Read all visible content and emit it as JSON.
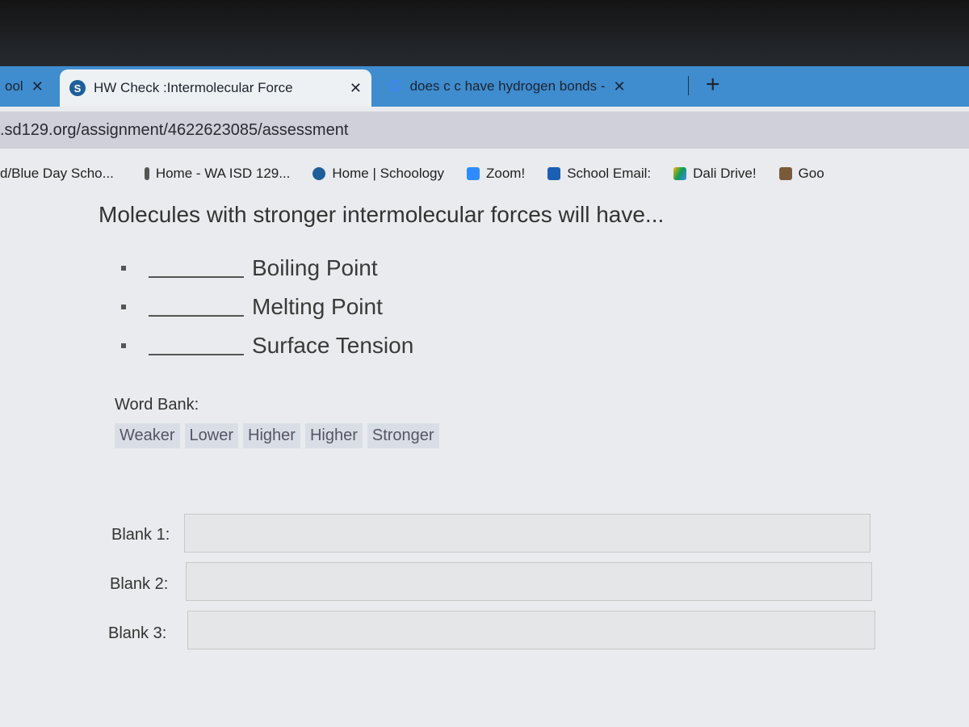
{
  "tabs": [
    {
      "label": "ool",
      "close": "✕"
    },
    {
      "label": "HW Check :Intermolecular Force",
      "close": "✕",
      "icon": "S"
    },
    {
      "label": "does c c have hydrogen bonds -",
      "close": "✕",
      "icon": "G"
    }
  ],
  "new_tab": "+",
  "url": ".sd129.org/assignment/4622623085/assessment",
  "bookmarks": [
    {
      "label": "d/Blue Day Scho..."
    },
    {
      "label": "Home - WA ISD 129..."
    },
    {
      "label": "Home | Schoology"
    },
    {
      "label": "Zoom!"
    },
    {
      "label": "School Email:"
    },
    {
      "label": "Dali Drive!"
    },
    {
      "label": "Goo"
    }
  ],
  "question": "Molecules with stronger intermolecular forces will have...",
  "items": [
    "Boiling Point",
    "Melting Point",
    "Surface Tension"
  ],
  "word_bank": {
    "label": "Word Bank:",
    "words": [
      "Weaker",
      "Lower",
      "Higher",
      "Higher",
      "Stronger"
    ]
  },
  "blanks": [
    {
      "label": "Blank 1:",
      "value": ""
    },
    {
      "label": "Blank 2:",
      "value": ""
    },
    {
      "label": "Blank 3:",
      "value": ""
    }
  ]
}
